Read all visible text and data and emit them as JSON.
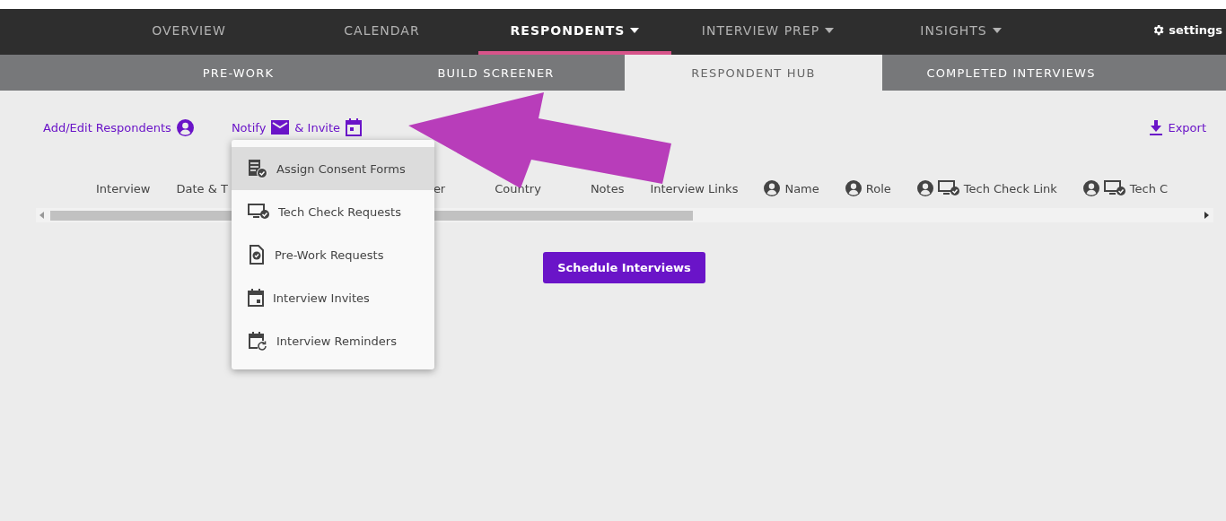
{
  "nav": {
    "tabs": [
      {
        "label": "OVERVIEW",
        "selected": false,
        "has_menu": false
      },
      {
        "label": "CALENDAR",
        "selected": false,
        "has_menu": false
      },
      {
        "label": "RESPONDENTS",
        "selected": true,
        "has_menu": true
      },
      {
        "label": "INTERVIEW PREP",
        "selected": false,
        "has_menu": true
      },
      {
        "label": "INSIGHTS",
        "selected": false,
        "has_menu": true
      }
    ],
    "settings": "settings"
  },
  "subnav": {
    "tabs": [
      {
        "label": "PRE-WORK",
        "selected": false
      },
      {
        "label": "BUILD SCREENER",
        "selected": false
      },
      {
        "label": "RESPONDENT HUB",
        "selected": true
      },
      {
        "label": "COMPLETED INTERVIEWS",
        "selected": false
      }
    ]
  },
  "toolbar": {
    "add_edit": "Add/Edit Respondents",
    "notify": "Notify",
    "invite": "& Invite",
    "export": "Export"
  },
  "menu": {
    "items": [
      {
        "label": "Assign Consent Forms",
        "kind": "consent",
        "selected": true
      },
      {
        "label": "Tech Check Requests",
        "kind": "tech",
        "selected": false
      },
      {
        "label": "Pre-Work Requests",
        "kind": "prework",
        "selected": false
      },
      {
        "label": "Interview Invites",
        "kind": "invite",
        "selected": false
      },
      {
        "label": "Interview Reminders",
        "kind": "reminder",
        "selected": false
      }
    ]
  },
  "table": {
    "columns": [
      {
        "label": "Interview",
        "kind": "plain"
      },
      {
        "label": "Date & T",
        "kind": "plain"
      },
      {
        "label": "er",
        "kind": "plain"
      },
      {
        "label": "Country",
        "kind": "plain"
      },
      {
        "label": "Notes",
        "kind": "plain"
      },
      {
        "label": "Interview Links",
        "kind": "plain"
      },
      {
        "label": "Name",
        "kind": "person"
      },
      {
        "label": "Role",
        "kind": "person"
      },
      {
        "label": "Tech Check Link",
        "kind": "person-tech"
      },
      {
        "label": "Tech C",
        "kind": "person-tech"
      }
    ]
  },
  "schedule_button": "Schedule Interviews"
}
